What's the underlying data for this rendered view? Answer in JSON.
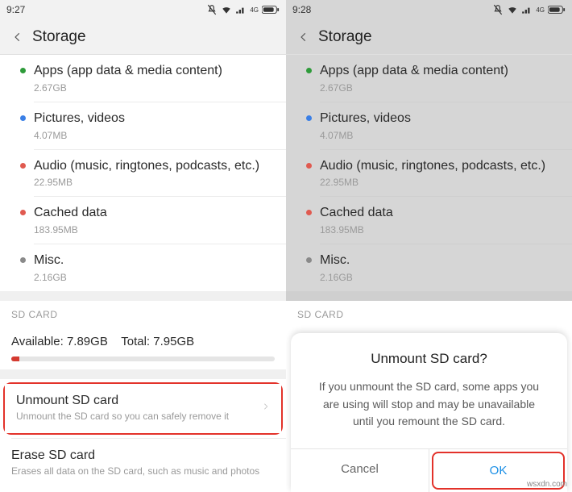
{
  "left": {
    "status_time": "9:27",
    "header_title": "Storage",
    "categories": [
      {
        "dot": "#2e9b3a",
        "title": "Apps (app data & media content)",
        "size": "2.67GB"
      },
      {
        "dot": "#3a7fe6",
        "title": "Pictures, videos",
        "size": "4.07MB"
      },
      {
        "dot": "#e05a50",
        "title": "Audio (music, ringtones, podcasts, etc.)",
        "size": "22.95MB"
      },
      {
        "dot": "#e05a50",
        "title": "Cached data",
        "size": "183.95MB"
      },
      {
        "dot": "#8a8a8a",
        "title": "Misc.",
        "size": "2.16GB"
      }
    ],
    "sd_header": "SD CARD",
    "sd_available_label": "Available:",
    "sd_available_value": "7.89GB",
    "sd_total_label": "Total:",
    "sd_total_value": "7.95GB",
    "unmount_title": "Unmount SD card",
    "unmount_sub": "Unmount the SD card so you can safely remove it",
    "erase_title": "Erase SD card",
    "erase_sub": "Erases all data on the SD card, such as music and photos"
  },
  "right": {
    "status_time": "9:28",
    "header_title": "Storage",
    "categories": [
      {
        "dot": "#2e9b3a",
        "title": "Apps (app data & media content)",
        "size": "2.67GB"
      },
      {
        "dot": "#3a7fe6",
        "title": "Pictures, videos",
        "size": "4.07MB"
      },
      {
        "dot": "#e05a50",
        "title": "Audio (music, ringtones, podcasts, etc.)",
        "size": "22.95MB"
      },
      {
        "dot": "#e05a50",
        "title": "Cached data",
        "size": "183.95MB"
      },
      {
        "dot": "#8a8a8a",
        "title": "Misc.",
        "size": "2.16GB"
      }
    ],
    "sd_header": "SD CARD",
    "dialog_title": "Unmount SD card?",
    "dialog_msg": "If you unmount the SD card, some apps you are using will stop and may be unavailable until you remount the SD card.",
    "dialog_cancel": "Cancel",
    "dialog_ok": "OK"
  },
  "watermark": "wsxdn.com"
}
